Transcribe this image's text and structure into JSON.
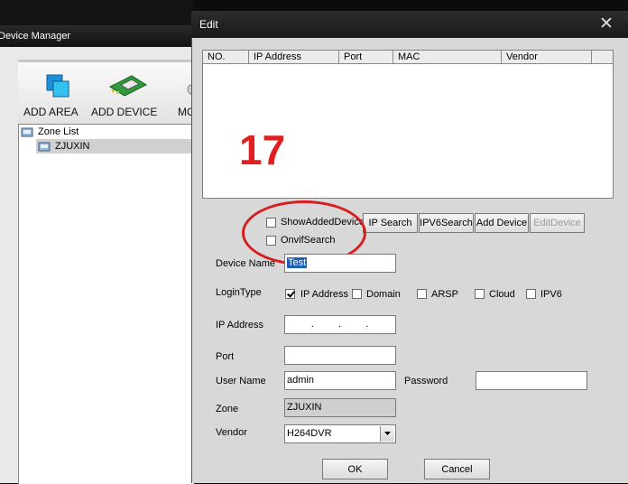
{
  "background_window": {
    "title": "Device Manager",
    "toolbar": [
      {
        "label": "ADD AREA",
        "icon": "add-area-icon"
      },
      {
        "label": "ADD DEVICE",
        "icon": "add-device-icon"
      },
      {
        "label": "MO",
        "icon": "modify-icon"
      }
    ],
    "tree": {
      "root": "Zone List",
      "child": "ZJUXIN"
    }
  },
  "dialog": {
    "title": "Edit",
    "close_glyph": "✕",
    "columns": [
      "NO.",
      "IP Address",
      "Port",
      "MAC",
      "Vendor"
    ],
    "show_added_label": "ShowAddedDevice",
    "onvif_label": "OnvifSearch",
    "buttons": {
      "ip_search": "IP Search",
      "ipv6_search": "IPV6Search",
      "add_device": "Add Device",
      "edit_device": "EditDevice",
      "ok": "OK",
      "cancel": "Cancel"
    },
    "form": {
      "device_name_label": "Device Name",
      "device_name_value": "Test",
      "login_type_label": "LoginType",
      "login_options": [
        {
          "label": "IP Address",
          "checked": true
        },
        {
          "label": "Domain",
          "checked": false
        },
        {
          "label": "ARSP",
          "checked": false
        },
        {
          "label": "Cloud",
          "checked": false
        },
        {
          "label": "IPV6",
          "checked": false
        }
      ],
      "ip_label": "IP Address",
      "ip_dots": ".    .    .",
      "port_label": "Port",
      "user_label": "User Name",
      "user_value": "admin",
      "password_label": "Password",
      "zone_label": "Zone",
      "zone_value": "ZJUXIN",
      "vendor_label": "Vendor",
      "vendor_value": "H264DVR"
    }
  },
  "annotation": {
    "number": "17",
    "color": "#e02020"
  }
}
